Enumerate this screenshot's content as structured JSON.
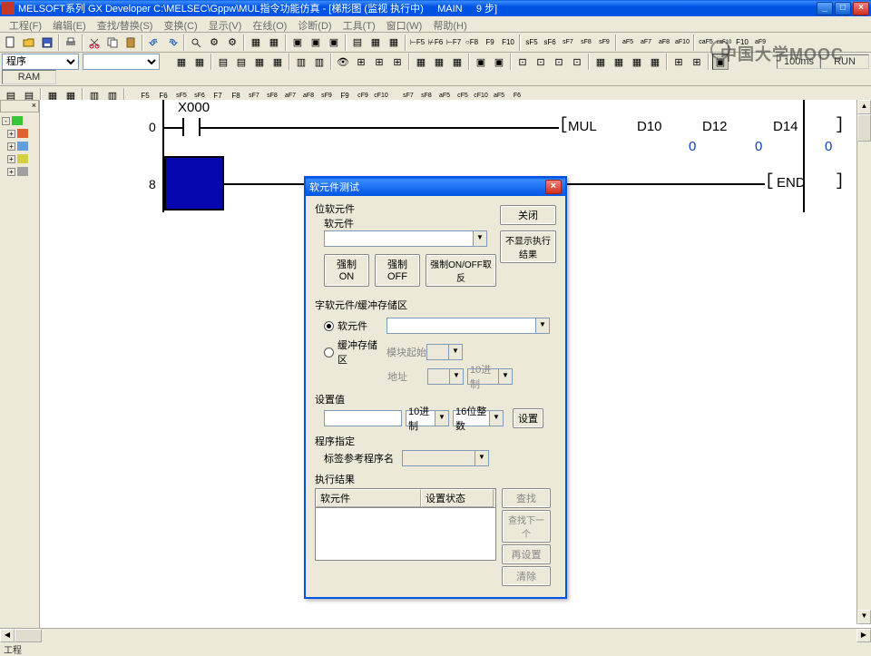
{
  "titlebar": {
    "text": "MELSOFT系列 GX Developer C:\\MELSEC\\Gppw\\MUL指令功能仿真 - [梯形图 (监视 执行中)     MAIN     9 步]"
  },
  "window_buttons": {
    "min": "_",
    "max": "□",
    "close": "×"
  },
  "menu": {
    "items": [
      "工程(F)",
      "编辑(E)",
      "查找/替换(S)",
      "变换(C)",
      "显示(V)",
      "在线(O)",
      "诊断(D)",
      "工具(T)",
      "窗口(W)",
      "帮助(H)"
    ]
  },
  "combo1": "程序",
  "status_cells": {
    "time": "100ms",
    "mode": "RUN",
    "mem": "RAM"
  },
  "ladder": {
    "x000": "X000",
    "rung0": "0",
    "rung8": "8",
    "op": "MUL",
    "d10": "D10",
    "d12": "D12",
    "d14": "D14",
    "v_d10": "0",
    "v_d12": "0",
    "v_d14": "0",
    "end": "END"
  },
  "dialog": {
    "title": "软元件测试",
    "section_bit": "位软元件",
    "label_device": "软元件",
    "btn_force_on": "强制 ON",
    "btn_force_off": "强制OFF",
    "btn_force_toggle": "强制ON/OFF取反",
    "btn_close": "关闭",
    "btn_hide_result": "不显示执行结果",
    "section_word": "字软元件/缓冲存储区",
    "radio_device": "软元件",
    "radio_buffer": "缓冲存储区",
    "label_module_start": "模块起始",
    "label_address": "地址",
    "addr_fmt": "10进制",
    "section_setval": "设置值",
    "fmt_dec": "10进制",
    "fmt_16bit": "16位整数",
    "btn_set": "设置",
    "section_prog": "程序指定",
    "label_prog_ref": "标签参考程序名",
    "section_result": "执行结果",
    "col_device": "软元件",
    "col_status": "设置状态",
    "btn_find": "查找",
    "btn_find_next": "查找下一个",
    "btn_reset": "再设置",
    "btn_clear": "清除"
  },
  "bottom": "工程",
  "watermark": "中国大学MOOC"
}
